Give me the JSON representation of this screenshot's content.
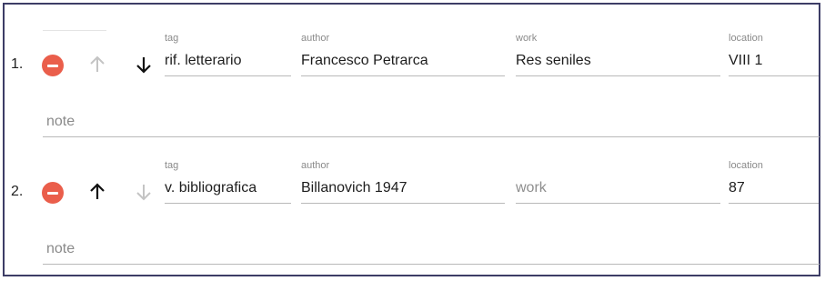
{
  "rows": [
    {
      "index": "1.",
      "fields": {
        "tag": {
          "label": "tag",
          "value": "rif. letterario"
        },
        "author": {
          "label": "author",
          "value": "Francesco Petrarca"
        },
        "work": {
          "label": "work",
          "value": "Res seniles"
        },
        "location": {
          "label": "location",
          "value": "VIII 1"
        }
      },
      "move_up_enabled": false,
      "move_down_enabled": true,
      "note_placeholder": "note"
    },
    {
      "index": "2.",
      "fields": {
        "tag": {
          "label": "tag",
          "value": "v. bibliografica"
        },
        "author": {
          "label": "author",
          "value": "Billanovich 1947"
        },
        "work": {
          "placeholder": "work"
        },
        "location": {
          "label": "location",
          "value": "87"
        }
      },
      "move_up_enabled": true,
      "move_down_enabled": false,
      "note_placeholder": "note"
    }
  ],
  "icons": {
    "remove": "minus-circle-icon",
    "up": "arrow-up-icon",
    "down": "arrow-down-icon"
  },
  "colors": {
    "remove_button": "#ea5e4b",
    "arrow_enabled": "#111111",
    "arrow_disabled": "#c4c4c4",
    "frame_border": "#3d3d66"
  }
}
